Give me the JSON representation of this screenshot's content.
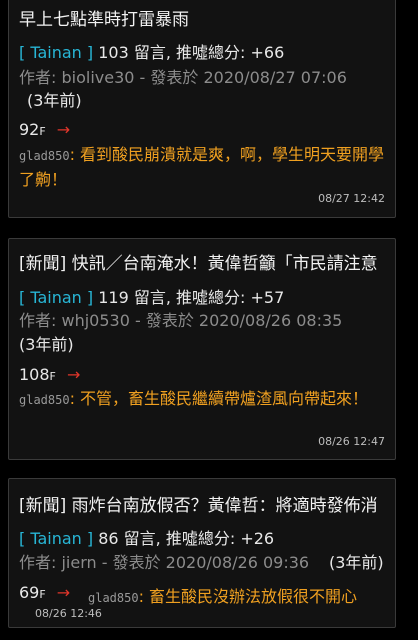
{
  "posts": [
    {
      "title": "早上七點準時打雷暴雨",
      "board": "[ Tainan ]",
      "stats": "103 留言, 推噓總分: +66",
      "author_line": "作者: biolive30 - 發表於 2020/08/27 07:06",
      "ago": "(3年前)",
      "floor_num": "92",
      "floor_suffix": "F",
      "arrow": "→",
      "reply_user": "glad850",
      "reply_text": ": 看到酸民崩潰就是爽，啊，學生明天要開學了齁！",
      "time": "08/27 12:42"
    },
    {
      "title": "[新聞] 快訊／台南淹水！黃偉哲籲「市民請注意",
      "board": "[ Tainan ]",
      "stats": "119 留言, 推噓總分: +57",
      "author_line": "作者: whj0530 - 發表於 2020/08/26 08:35",
      "ago": "(3年前)",
      "floor_num": "108",
      "floor_suffix": "F",
      "arrow": "→",
      "reply_user": "glad850",
      "reply_text": ": 不管，畜生酸民繼續帶爐渣風向帶起來！",
      "time": "08/26 12:47"
    },
    {
      "title": "[新聞] 雨炸台南放假否？黃偉哲：將適時發佈消",
      "board": "[ Tainan ]",
      "stats": "86 留言, 推噓總分: +26",
      "author_line": "作者: jiern - 發表於 2020/08/26 09:36",
      "ago": "(3年前)",
      "floor_num": "69",
      "floor_suffix": "F",
      "arrow": "→",
      "reply_user": "glad850",
      "reply_text": ": 畜生酸民沒辦法放假很不開心",
      "time": "08/26 12:46"
    }
  ]
}
